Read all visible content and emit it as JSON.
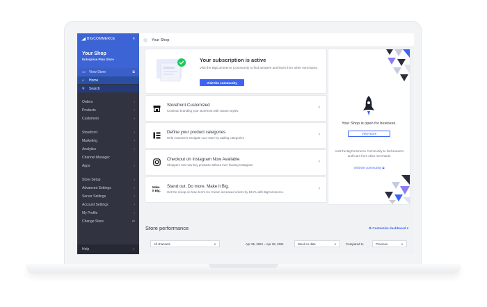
{
  "sidebar": {
    "logo_text": "BIGCOMMERCE",
    "collapse_icon": "double-chevron-left-icon",
    "store_name": "Your Shop",
    "plan": "Enterprise Plan Store",
    "view_store": "View Store",
    "home": "Home",
    "search": "Search",
    "groups": [
      {
        "items": [
          "Orders",
          "Products",
          "Customers"
        ]
      },
      {
        "items": [
          "Storefront",
          "Marketing",
          "Analytics",
          "Channel Manager",
          "Apps"
        ]
      },
      {
        "items": [
          "Store Setup",
          "Advanced Settings",
          "Server Settings",
          "Account Settings",
          "My Profile",
          "Change Store"
        ]
      }
    ],
    "help": "Help"
  },
  "topbar": {
    "title": "Your Shop"
  },
  "subscription": {
    "title": "Your subscription is active",
    "description": "Visit the BigCommerce Community to find answers and learn from other merchants.",
    "button": "Visit the community"
  },
  "cards": [
    {
      "icon": "storefront-icon",
      "title": "Storefront Customized",
      "description": "Continue branding your storefront with custom styles."
    },
    {
      "icon": "category-icon",
      "title": "Define your product categories",
      "description": "Help customers navigate your store by adding categories"
    },
    {
      "icon": "instagram-icon",
      "title": "Checkout on Instagram Now Available",
      "description": "Shoppers can now buy products without ever leaving Instagram"
    },
    {
      "icon": "make-it-big-icon",
      "icon_text": "Make it Big.",
      "title": "Stand out. Do more. Make it Big.",
      "description": "Get the scoop on how Jeni's Ice Cream increased orders by 194% with BigCommerce."
    }
  ],
  "open_card": {
    "message": "Your Shop is open for business.",
    "button": "View store",
    "description": "Visit the BigCommerce Community to find answers and learn from other merchants.",
    "link": "Visit the community"
  },
  "performance": {
    "title": "Store performance",
    "customize": "Customize dashboard",
    "channel": "All channels",
    "date_range": "Apr 25, 2021 – Apr 26, 2021",
    "period": "Week to date",
    "compared_to_label": "Compared to",
    "compared_to": "Previous"
  },
  "colors": {
    "brand_blue": "#3c64f4",
    "sidebar": "#313440",
    "sidebar_header": "#3c64d4"
  }
}
